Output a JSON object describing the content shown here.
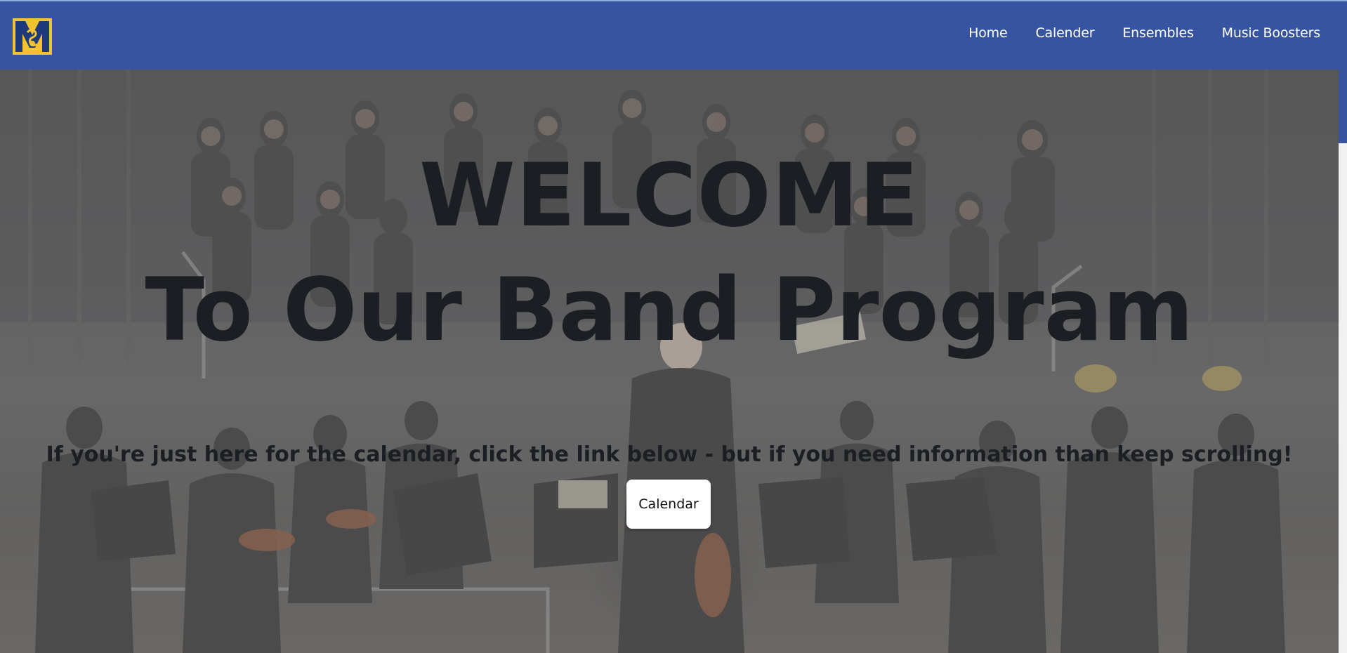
{
  "navbar": {
    "logo_alt": "MG",
    "links": [
      "Home",
      "Calender",
      "Ensembles",
      "Music Boosters"
    ]
  },
  "hero": {
    "title_line1": "WELCOME",
    "title_line2": "To Our Band Program",
    "subtitle": "If you're just here for the calendar, click the link below - but if you need information than keep scrolling!",
    "button_label": "Calendar"
  },
  "colors": {
    "navbar": "#3754a0",
    "logo_gold": "#f2c230",
    "logo_blue": "#1f3a7a",
    "title_text": "#1b1e22",
    "button_bg": "#ffffff"
  }
}
